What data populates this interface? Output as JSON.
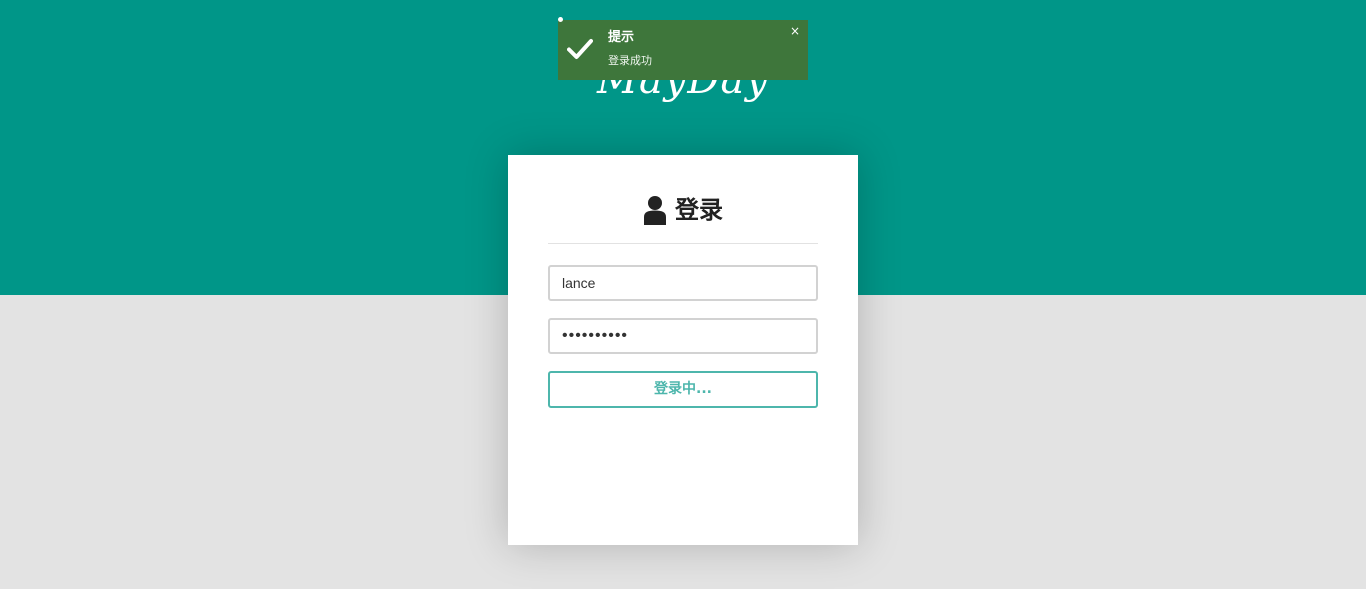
{
  "brand": {
    "text": "MayDay"
  },
  "login": {
    "title": "登录",
    "username_value": "lance",
    "password_mask": "••••••••••",
    "submit_label": "登录中..."
  },
  "toast": {
    "title": "提示",
    "message": "登录成功",
    "close_label": "×"
  },
  "colors": {
    "banner": "#009688",
    "background": "#e3e3e3",
    "toast": "#3e763b",
    "accent": "#4db6ac"
  },
  "icons": {
    "login": "user-icon",
    "toast": "check-icon"
  }
}
